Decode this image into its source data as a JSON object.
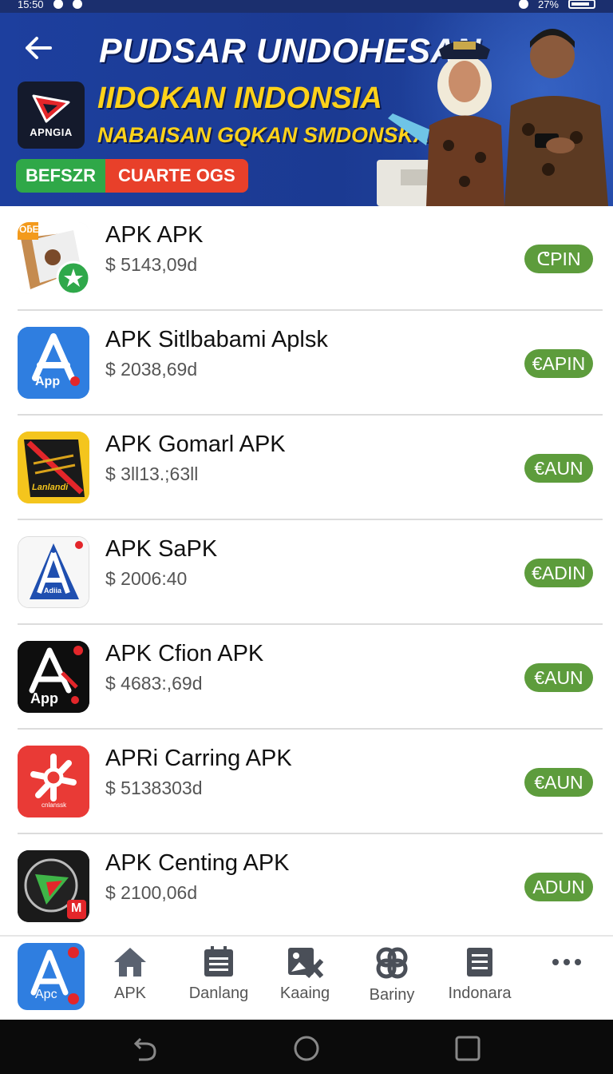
{
  "status_bar": {
    "time": "15:50",
    "battery": "27%"
  },
  "banner": {
    "title": "PUDSAR UNDOHESAN",
    "subtitle_1": "IIDOKAN INDONSIA",
    "subtitle_2": "NABAISAN GQKAN SMDONSKA",
    "logo_text": "APNGIA",
    "pill_left": "BEFSZR",
    "pill_right": "CUARTE OGS",
    "colors": {
      "background": "#1d3f9e",
      "accent_yellow": "#ffd21a",
      "pill_green": "#2fa848",
      "pill_red": "#e8402a"
    }
  },
  "apps": [
    {
      "name": "APK APK",
      "price": "$ 5143,09d",
      "button": "ᕦPIN",
      "icon": "puzzle-icon",
      "icon_badge": "OƃE"
    },
    {
      "name": "APK Sitlbabami Aplsk",
      "price": "$ 2038,69d",
      "button": "€APIN",
      "icon": "app-store-icon",
      "icon_badge": "App"
    },
    {
      "name": "APK Gomarl APK",
      "price": "$ 3ll13.;63ll",
      "button": "€AUN",
      "icon": "game-icon",
      "icon_badge": "Lanlandi"
    },
    {
      "name": "APK SaPK",
      "price": "$ 2006:40",
      "button": "€ADIN",
      "icon": "app-store-icon",
      "icon_badge": "Adiia"
    },
    {
      "name": "APK Cfion APK",
      "price": "$ 4683:,69d",
      "button": "€AUN",
      "icon": "app-store-icon",
      "icon_badge": "App"
    },
    {
      "name": "APRi Carring APK",
      "price": "$ 5138303d",
      "button": "€AUN",
      "icon": "tools-icon",
      "icon_badge": "cnlanssk"
    },
    {
      "name": "APK Centing APK",
      "price": "$ 2100,06d",
      "button": "ADUN",
      "icon": "play-icon",
      "icon_badge": "M"
    }
  ],
  "bottom_nav": {
    "app_badge": "Apc",
    "items": [
      {
        "label": "APK",
        "icon": "home-icon"
      },
      {
        "label": "Danlang",
        "icon": "calendar-icon"
      },
      {
        "label": "Kaaing",
        "icon": "image-icon"
      },
      {
        "label": "Bariny",
        "icon": "knot-icon"
      },
      {
        "label": "Indonara",
        "icon": "document-icon"
      }
    ],
    "more_icon": "more-icon"
  },
  "colors": {
    "get_button": "#5d9c3c",
    "divider": "#dcdcdc"
  }
}
